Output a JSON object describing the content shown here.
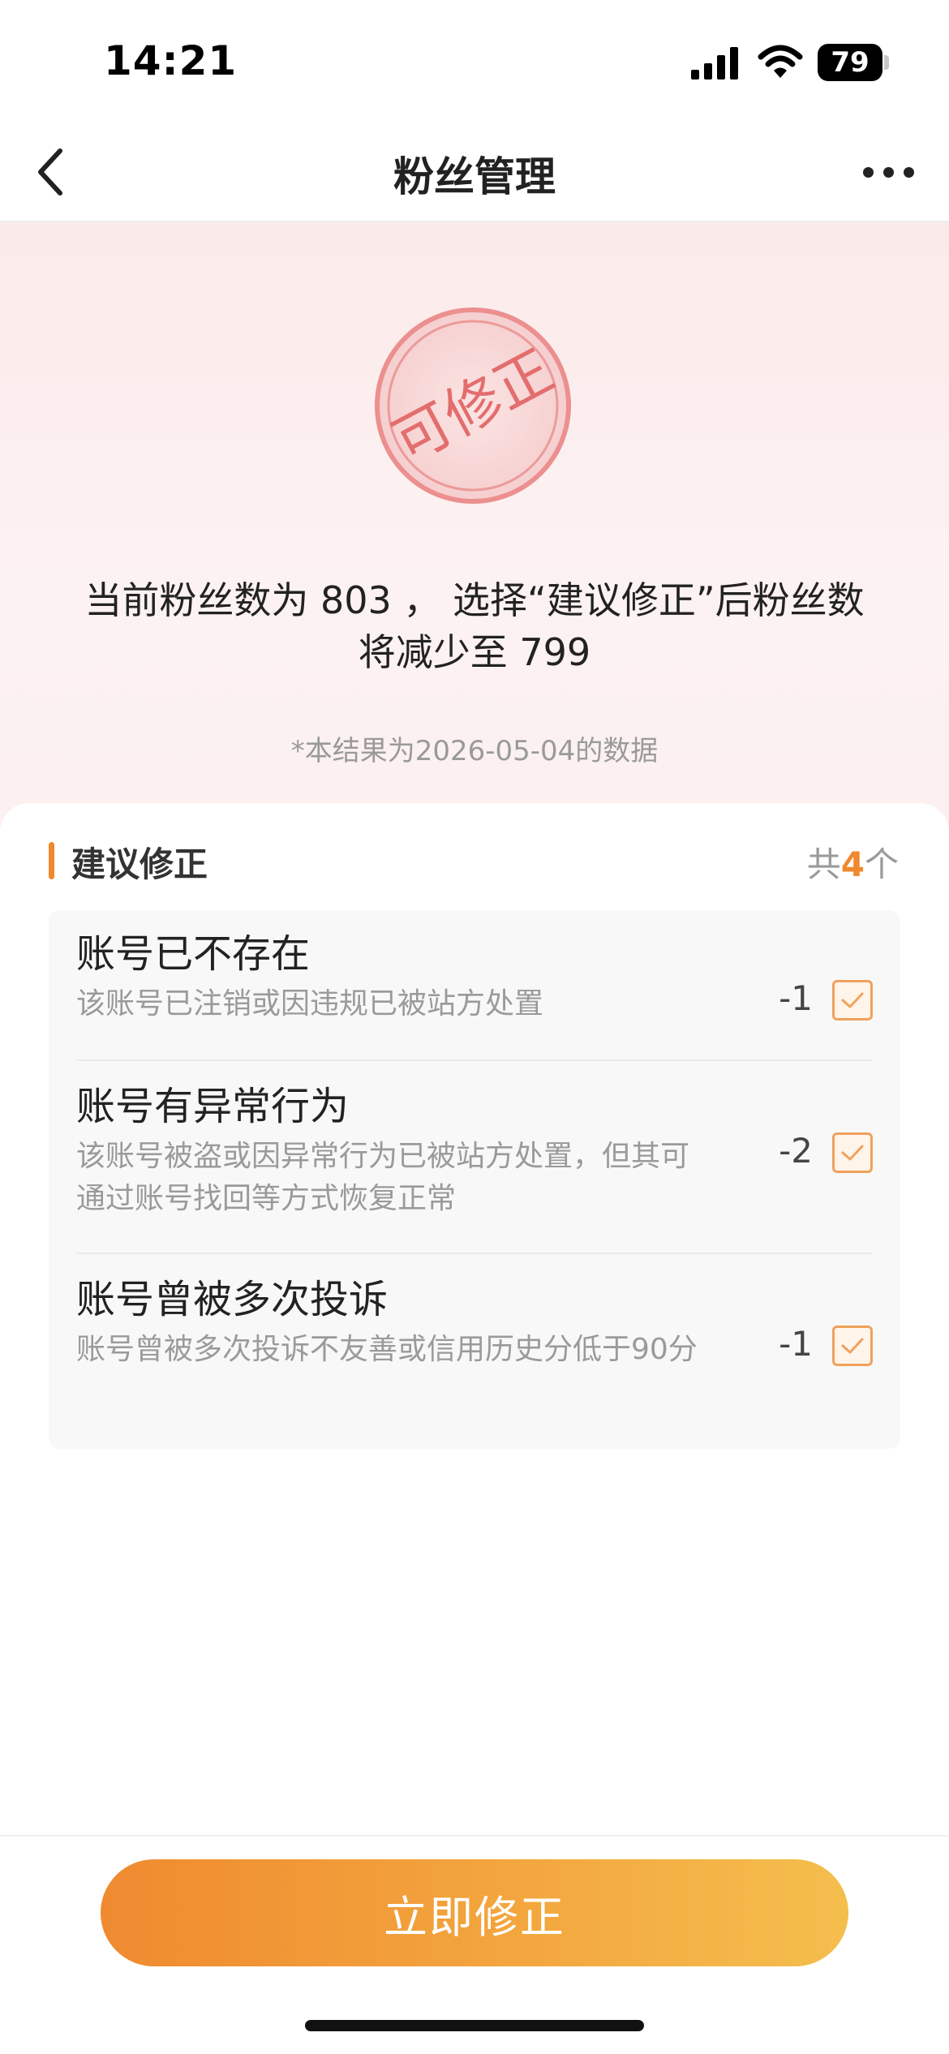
{
  "status_bar": {
    "time": "14:21",
    "battery": "79"
  },
  "nav": {
    "title": "粉丝管理"
  },
  "hero": {
    "stamp_text": "可修正",
    "summary_line1": "当前粉丝数为 803 ， 选择“建议修正”后粉丝数",
    "summary_line2": "将减少至 799",
    "note": "*本结果为2026-05-04的数据"
  },
  "section": {
    "title": "建议修正",
    "count_prefix": "共",
    "count_value": "4",
    "count_suffix": "个"
  },
  "items": [
    {
      "title": "账号已不存在",
      "desc": "该账号已注销或因违规已被站方处置",
      "value": "-1",
      "checked": true
    },
    {
      "title": "账号有异常行为",
      "desc": "该账号被盗或因异常行为已被站方处置，但其可通过账号找回等方式恢复正常",
      "value": "-2",
      "checked": true
    },
    {
      "title": "账号曾被多次投诉",
      "desc": "账号曾被多次投诉不友善或信用历史分低于90分",
      "value": "-1",
      "checked": true
    }
  ],
  "action": {
    "button_label": "立即修正"
  },
  "colors": {
    "accent": "#f0882e",
    "stamp": "#e87777"
  }
}
